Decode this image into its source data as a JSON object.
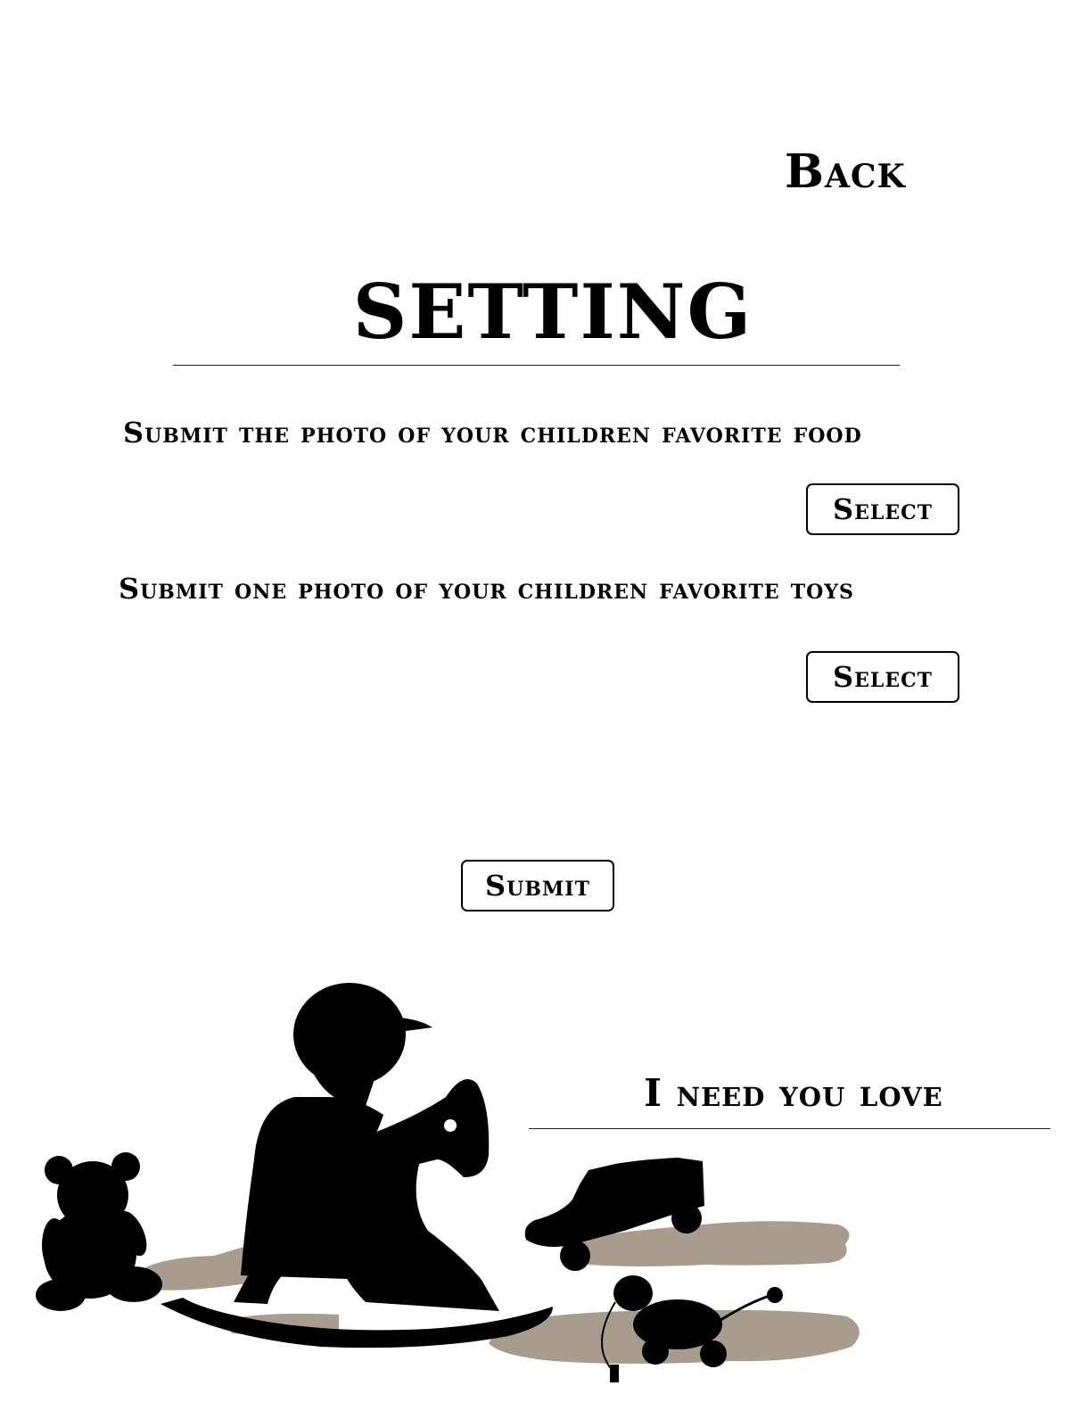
{
  "header": {
    "back_label": "Back",
    "title": "SETTING"
  },
  "form": {
    "food_prompt": "Submit the photo of your children favorite food",
    "food_select_label": "Select",
    "toys_prompt": "Submit one photo of your children favorite toys",
    "toys_select_label": "Select",
    "submit_label": "Submit"
  },
  "footer": {
    "tagline": "I need you love"
  },
  "illustration": {
    "description_icon": "child-rocking-horse-silhouette-icon",
    "colors": {
      "silhouette": "#000000",
      "shadow": "#a89c8d"
    }
  }
}
